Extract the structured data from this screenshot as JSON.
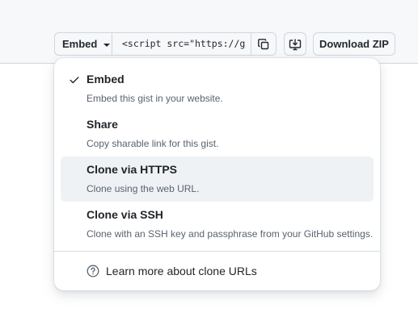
{
  "toolbar": {
    "embed_label": "Embed",
    "url_value": "<script src=\"https://g",
    "download_zip_label": "Download ZIP"
  },
  "menu": {
    "items": [
      {
        "title": "Embed",
        "description": "Embed this gist in your website.",
        "selected": true
      },
      {
        "title": "Share",
        "description": "Copy sharable link for this gist.",
        "selected": false
      },
      {
        "title": "Clone via HTTPS",
        "description": "Clone using the web URL.",
        "selected": false
      },
      {
        "title": "Clone via SSH",
        "description": "Clone with an SSH key and passphrase from your GitHub settings.",
        "selected": false
      }
    ],
    "learn_more": "Learn more about clone URLs"
  },
  "icons": {
    "check": "check-icon",
    "copy": "copy-icon",
    "desktop_download": "desktop-download-icon",
    "question": "question-icon",
    "caret": "chevron-down-icon"
  },
  "colors": {
    "hover_bg": "#eff2f5",
    "text": "#1f2328",
    "muted": "#59636e",
    "border": "#d0d7de"
  }
}
